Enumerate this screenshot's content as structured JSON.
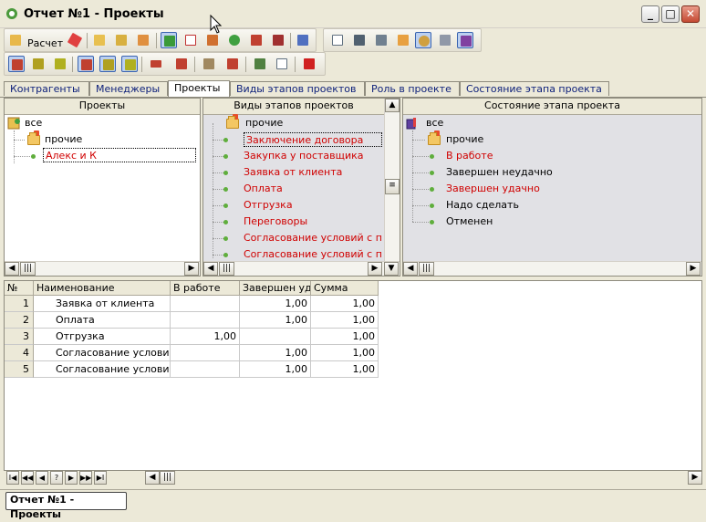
{
  "window": {
    "title": "Отчет №1 - Проекты",
    "minimize": "_",
    "maximize": "□",
    "close": "✕"
  },
  "toolbar": {
    "calc_label": "Расчет"
  },
  "tabs": [
    "Контрагенты",
    "Менеджеры",
    "Проекты",
    "Виды этапов проектов",
    "Роль в проекте",
    "Состояние этапа проекта"
  ],
  "active_tab": "Проекты",
  "panels": {
    "projects": {
      "header": "Проекты",
      "root": "все",
      "folder": "прочие",
      "item": "Алекс и К"
    },
    "stage_types": {
      "header": "Виды этапов проектов",
      "folder": "прочие",
      "items": [
        "Заключение договора",
        "Закупка у поставщика",
        "Заявка от клиента",
        "Оплата",
        "Отгрузка",
        "Переговоры",
        "Согласование условий с поку",
        "Согласование условий с пост"
      ]
    },
    "stage_state": {
      "header": "Состояние этапа проекта",
      "root": "все",
      "folder": "прочие",
      "items": [
        {
          "label": "В работе",
          "color": "#d00000"
        },
        {
          "label": "Завершен неудачно",
          "color": "#000000"
        },
        {
          "label": "Завершен удачно",
          "color": "#d00000"
        },
        {
          "label": "Надо сделать",
          "color": "#000000"
        },
        {
          "label": "Отменен",
          "color": "#000000"
        }
      ]
    }
  },
  "grid": {
    "columns": [
      "№",
      "Наименование",
      "В работе",
      "Завершен уда",
      "Сумма"
    ],
    "rows": [
      {
        "n": "1",
        "name": "Заявка от клиента",
        "in_work": "",
        "done": "1,00",
        "sum": "1,00"
      },
      {
        "n": "2",
        "name": "Оплата",
        "in_work": "",
        "done": "1,00",
        "sum": "1,00"
      },
      {
        "n": "3",
        "name": "Отгрузка",
        "in_work": "1,00",
        "done": "",
        "sum": "1,00"
      },
      {
        "n": "4",
        "name": "Согласование условий с",
        "in_work": "",
        "done": "1,00",
        "sum": "1,00"
      },
      {
        "n": "5",
        "name": "Согласование условий с",
        "in_work": "",
        "done": "1,00",
        "sum": "1,00"
      }
    ]
  },
  "nav": {
    "buttons": [
      "I◀",
      "◀◀",
      "◀",
      "?",
      "▶",
      "▶▶",
      "▶I"
    ]
  },
  "taskbar": {
    "window_button": "Отчет №1 - Проекты"
  }
}
